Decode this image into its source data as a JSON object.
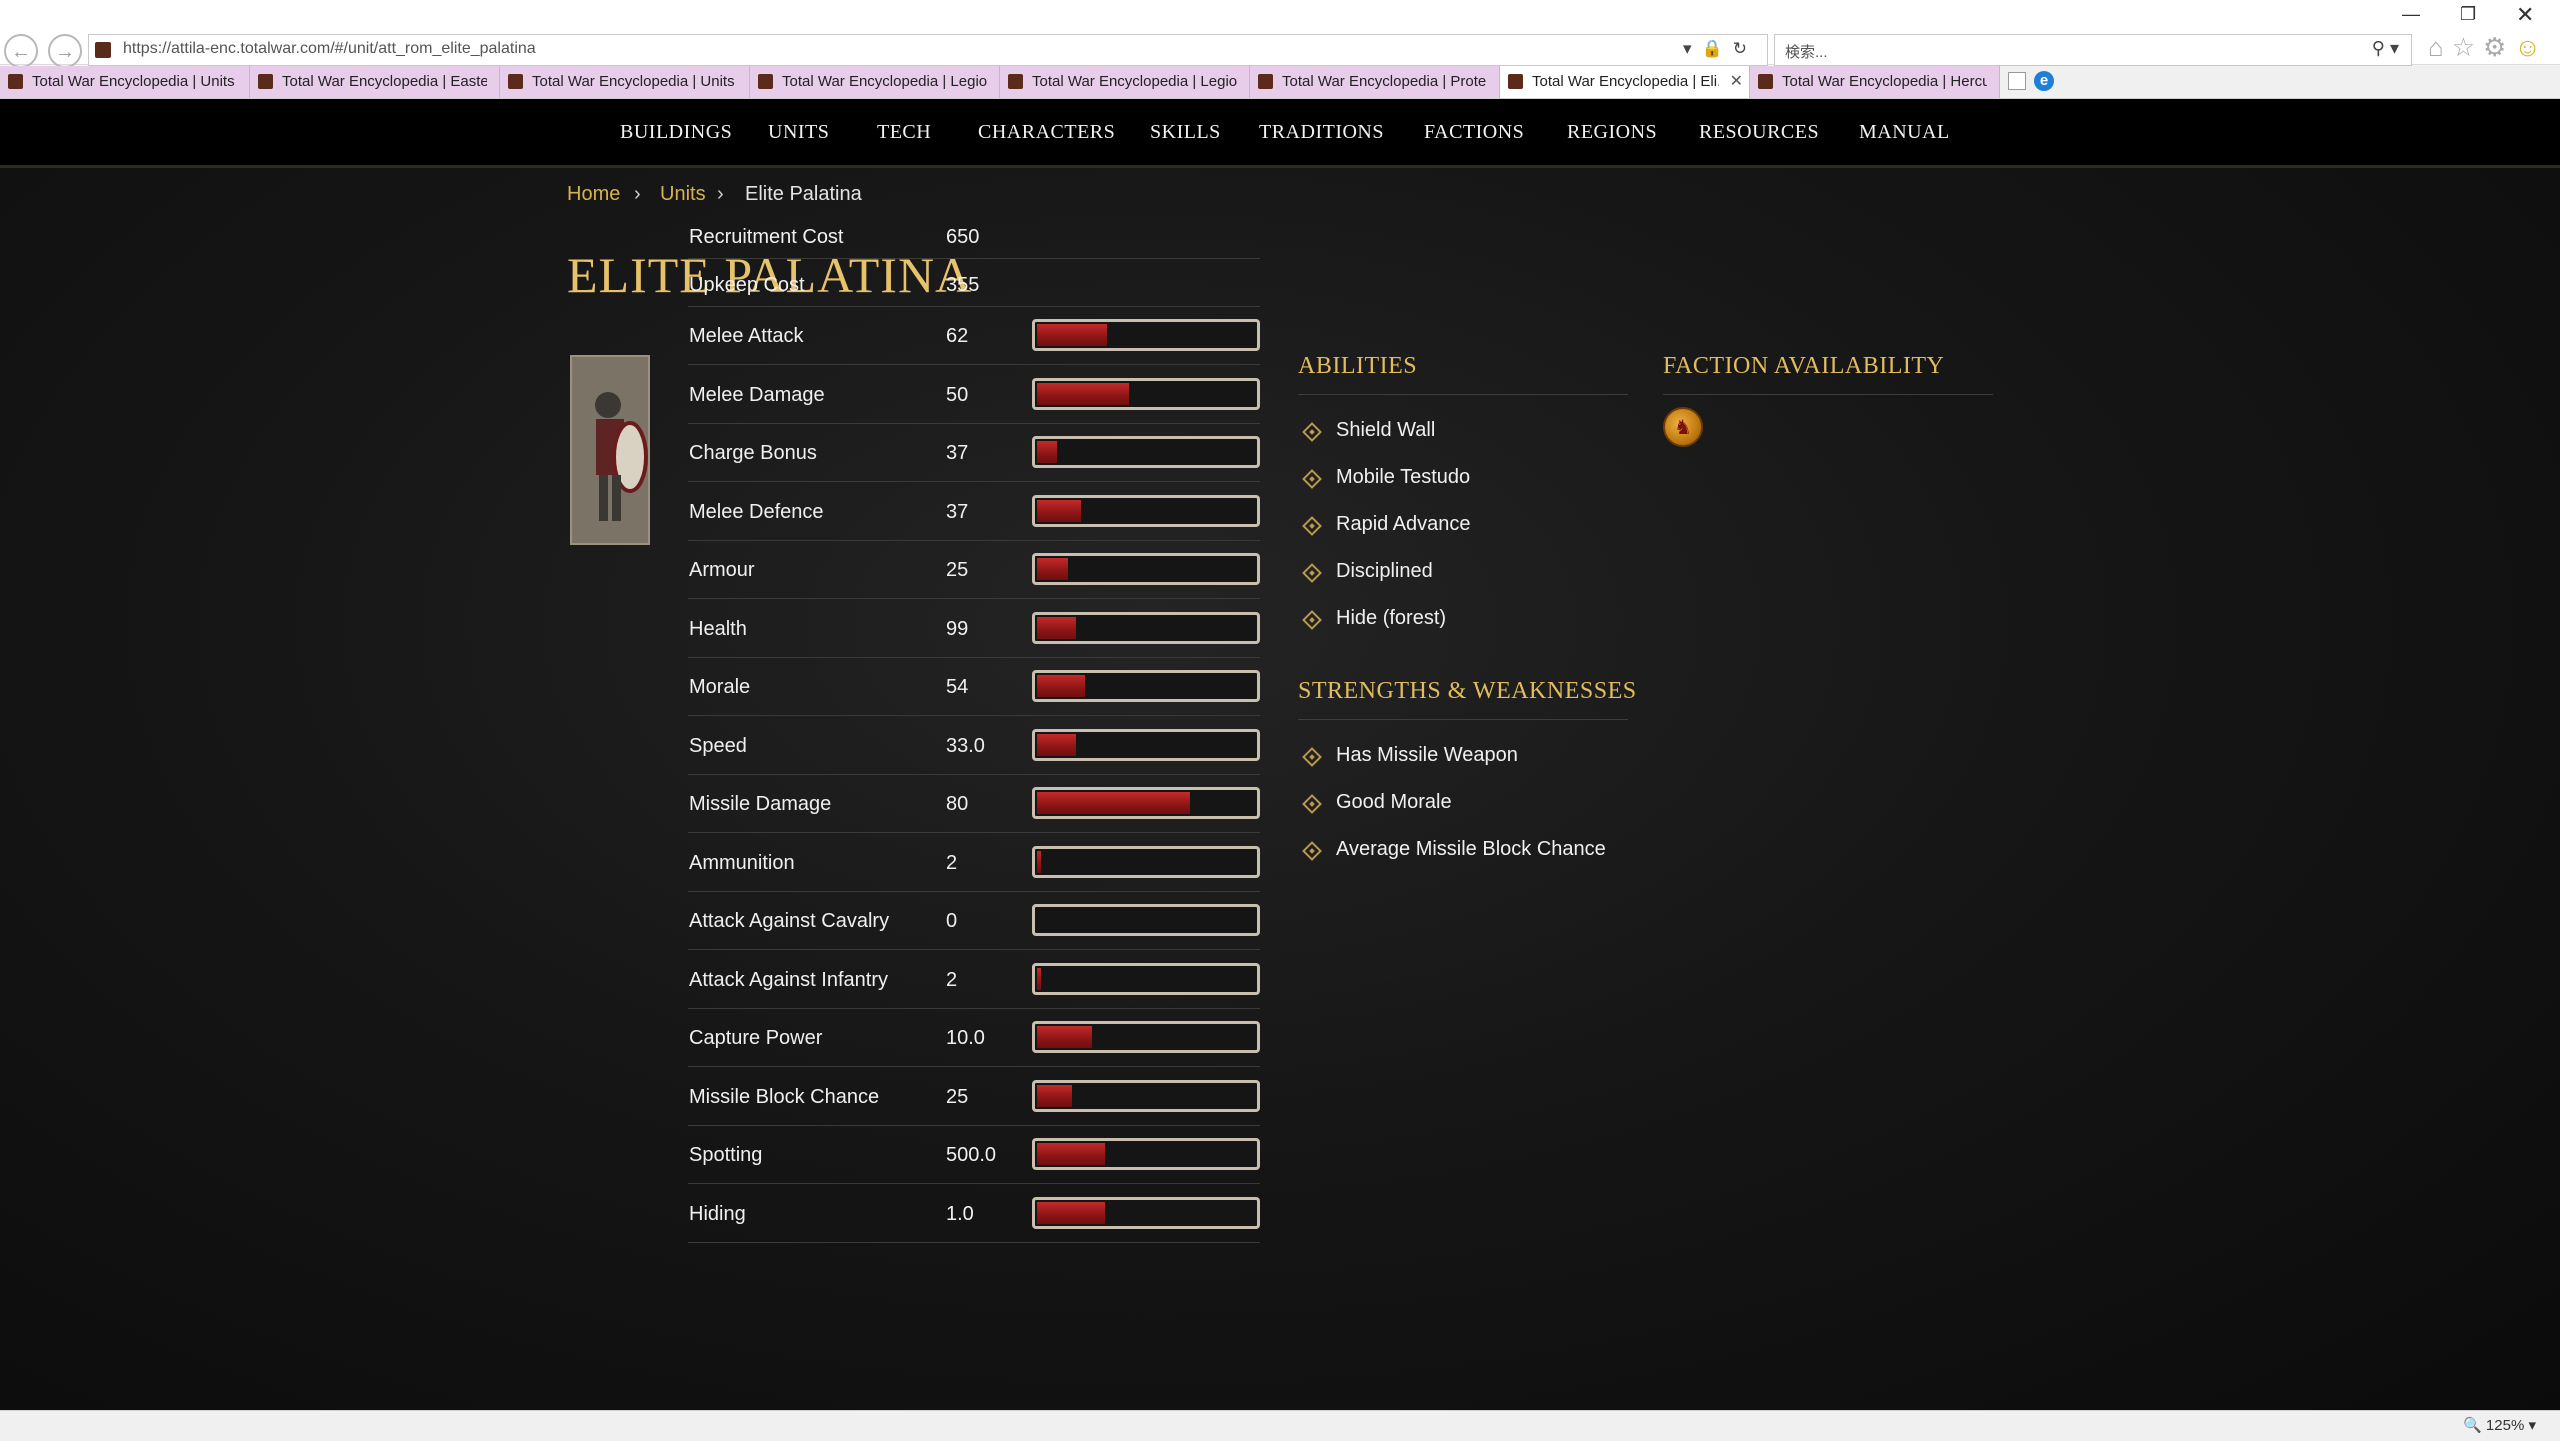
{
  "browser": {
    "url": "https://attila-enc.totalwar.com/#/unit/att_rom_elite_palatina",
    "search_placeholder": "検索...",
    "zoom": "125%",
    "tabs": [
      {
        "title": "Total War Encyclopedia | Units",
        "active": false
      },
      {
        "title": "Total War Encyclopedia | Easte...",
        "active": false
      },
      {
        "title": "Total War Encyclopedia | Units",
        "active": false
      },
      {
        "title": "Total War Encyclopedia | Legio",
        "active": false
      },
      {
        "title": "Total War Encyclopedia | Legio...",
        "active": false
      },
      {
        "title": "Total War Encyclopedia | Prote...",
        "active": false
      },
      {
        "title": "Total War Encyclopedia | Eli...",
        "active": true
      },
      {
        "title": "Total War Encyclopedia | Hercu...",
        "active": false
      }
    ]
  },
  "nav": [
    "BUILDINGS",
    "UNITS",
    "TECH",
    "CHARACTERS",
    "SKILLS",
    "TRADITIONS",
    "FACTIONS",
    "REGIONS",
    "RESOURCES",
    "MANUAL"
  ],
  "breadcrumb": [
    "Home",
    "Units",
    "Elite Palatina"
  ],
  "unit": {
    "name": "ELITE PALATINA",
    "costs": [
      {
        "label": "Recruitment Cost",
        "value": "650"
      },
      {
        "label": "Upkeep Cost",
        "value": "355"
      }
    ],
    "stats": [
      {
        "label": "Melee Attack",
        "value": "62",
        "fill": 0.32
      },
      {
        "label": "Melee Damage",
        "value": "50",
        "fill": 0.42
      },
      {
        "label": "Charge Bonus",
        "value": "37",
        "fill": 0.09
      },
      {
        "label": "Melee Defence",
        "value": "37",
        "fill": 0.2
      },
      {
        "label": "Armour",
        "value": "25",
        "fill": 0.14
      },
      {
        "label": "Health",
        "value": "99",
        "fill": 0.18
      },
      {
        "label": "Morale",
        "value": "54",
        "fill": 0.22
      },
      {
        "label": "Speed",
        "value": "33.0",
        "fill": 0.18
      },
      {
        "label": "Missile Damage",
        "value": "80",
        "fill": 0.7
      },
      {
        "label": "Ammunition",
        "value": "2",
        "fill": 0.02
      },
      {
        "label": "Attack Against Cavalry",
        "value": "0",
        "fill": 0.0
      },
      {
        "label": "Attack Against Infantry",
        "value": "2",
        "fill": 0.02
      },
      {
        "label": "Capture Power",
        "value": "10.0",
        "fill": 0.25
      },
      {
        "label": "Missile Block Chance",
        "value": "25",
        "fill": 0.16
      },
      {
        "label": "Spotting",
        "value": "500.0",
        "fill": 0.31
      },
      {
        "label": "Hiding",
        "value": "1.0",
        "fill": 0.31
      }
    ]
  },
  "abilities": {
    "title": "ABILITIES",
    "items": [
      "Shield Wall",
      "Mobile Testudo",
      "Rapid Advance",
      "Disciplined",
      "Hide (forest)"
    ]
  },
  "strengths": {
    "title": "STRENGTHS & WEAKNESSES",
    "items": [
      "Has Missile Weapon",
      "Good Morale",
      "Average Missile Block Chance"
    ]
  },
  "faction": {
    "title": "FACTION AVAILABILITY"
  },
  "icons": {
    "back": "back-arrow-icon",
    "forward": "forward-arrow-icon",
    "lock": "lock-icon",
    "refresh": "refresh-icon",
    "search": "search-icon",
    "home": "home-icon",
    "favorites": "star-icon",
    "settings": "gear-icon",
    "smiley": "smiley-icon",
    "ability_bullet": "diamond-icon",
    "faction": "faction-emblem-icon"
  },
  "colors": {
    "accent_gold": "#e2bd5e",
    "bar_fill": "#b01e1e",
    "background": "#141414"
  }
}
